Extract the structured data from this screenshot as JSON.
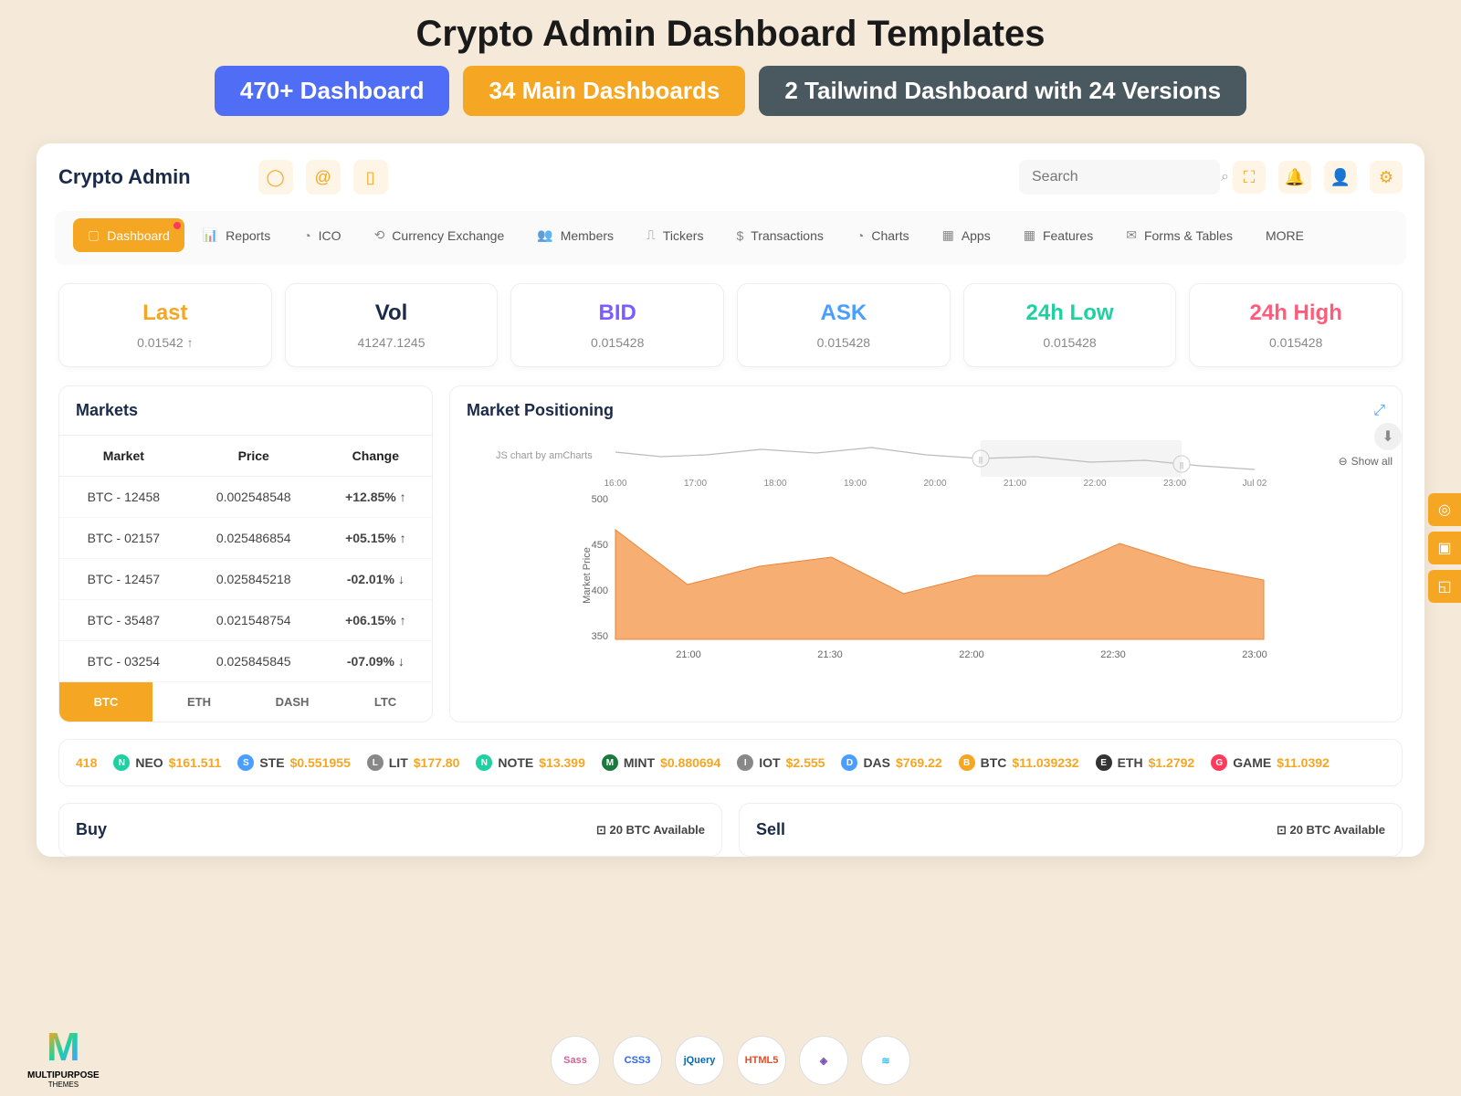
{
  "promo": {
    "title": "Crypto Admin Dashboard Templates",
    "badge1": "470+ Dashboard",
    "badge2": "34 Main Dashboards",
    "badge3": "2 Tailwind Dashboard with 24 Versions"
  },
  "brand": "Crypto Admin",
  "search_placeholder": "Search",
  "nav": [
    {
      "label": "Dashboard",
      "active": true,
      "dot": true,
      "icon": "▢"
    },
    {
      "label": "Reports",
      "icon": "📊"
    },
    {
      "label": "ICO",
      "icon": "◔"
    },
    {
      "label": "Currency Exchange",
      "icon": "⟲"
    },
    {
      "label": "Members",
      "icon": "👥"
    },
    {
      "label": "Tickers",
      "icon": "⎍"
    },
    {
      "label": "Transactions",
      "icon": "$"
    },
    {
      "label": "Charts",
      "icon": "◔"
    },
    {
      "label": "Apps",
      "icon": "▦"
    },
    {
      "label": "Features",
      "icon": "▦"
    },
    {
      "label": "Forms & Tables",
      "icon": "✉"
    },
    {
      "label": "MORE"
    }
  ],
  "stats": [
    {
      "label": "Last",
      "value": "0.01542 ↑",
      "cls": "stat-orange"
    },
    {
      "label": "Vol",
      "value": "41247.1245",
      "cls": "stat-dark"
    },
    {
      "label": "BID",
      "value": "0.015428",
      "cls": "stat-purple"
    },
    {
      "label": "ASK",
      "value": "0.015428",
      "cls": "stat-blue"
    },
    {
      "label": "24h Low",
      "value": "0.015428",
      "cls": "stat-teal"
    },
    {
      "label": "24h High",
      "value": "0.015428",
      "cls": "stat-red"
    }
  ],
  "markets": {
    "title": "Markets",
    "headers": [
      "Market",
      "Price",
      "Change"
    ],
    "rows": [
      {
        "market": "BTC - 12458",
        "price": "0.002548548",
        "change": "+12.85%",
        "dir": "up"
      },
      {
        "market": "BTC - 02157",
        "price": "0.025486854",
        "change": "+05.15%",
        "dir": "up"
      },
      {
        "market": "BTC - 12457",
        "price": "0.025845218",
        "change": "-02.01%",
        "dir": "down"
      },
      {
        "market": "BTC - 35487",
        "price": "0.021548754",
        "change": "+06.15%",
        "dir": "up"
      },
      {
        "market": "BTC - 03254",
        "price": "0.025845845",
        "change": "-07.09%",
        "dir": "down"
      }
    ],
    "tabs": [
      "BTC",
      "ETH",
      "DASH",
      "LTC"
    ],
    "active_tab": "BTC"
  },
  "chart": {
    "title": "Market Positioning",
    "credit": "JS chart by amCharts",
    "showall": "Show all",
    "ylabel": "Market Price"
  },
  "chart_data": {
    "type": "area",
    "title": "Market Positioning",
    "ylabel": "Market Price",
    "ylim": [
      350,
      500
    ],
    "overview_x_ticks": [
      "16:00",
      "17:00",
      "18:00",
      "19:00",
      "20:00",
      "21:00",
      "22:00",
      "23:00",
      "Jul 02"
    ],
    "x_ticks": [
      "21:00",
      "21:30",
      "22:00",
      "22:30",
      "23:00"
    ],
    "x": [
      "20:45",
      "21:00",
      "21:15",
      "21:30",
      "21:45",
      "22:00",
      "22:15",
      "22:30",
      "22:45",
      "23:00"
    ],
    "values": [
      470,
      410,
      430,
      440,
      400,
      420,
      420,
      455,
      430,
      415
    ]
  },
  "ticker_lead": "418",
  "ticker": [
    {
      "sym": "NEO",
      "price": "$161.511",
      "color": "#1dd1a1"
    },
    {
      "sym": "STE",
      "price": "$0.551955",
      "color": "#4a9eff"
    },
    {
      "sym": "LIT",
      "price": "$177.80",
      "color": "#888"
    },
    {
      "sym": "NOTE",
      "price": "$13.399",
      "color": "#1dd1a1"
    },
    {
      "sym": "MINT",
      "price": "$0.880694",
      "color": "#1a7a3d"
    },
    {
      "sym": "IOT",
      "price": "$2.555",
      "color": "#888"
    },
    {
      "sym": "DAS",
      "price": "$769.22",
      "color": "#4a9eff"
    },
    {
      "sym": "BTC",
      "price": "$11.039232",
      "color": "#f5a623"
    },
    {
      "sym": "ETH",
      "price": "$1.2792",
      "color": "#333"
    },
    {
      "sym": "GAME",
      "price": "$11.0392",
      "color": "#ff3b5c"
    }
  ],
  "buy": {
    "title": "Buy",
    "avail": "⊡ 20 BTC Available"
  },
  "sell": {
    "title": "Sell",
    "avail": "⊡ 20 BTC Available"
  },
  "tech": [
    "Sass",
    "CSS3",
    "jQuery",
    "HTML5",
    "◈",
    "≋"
  ],
  "mp_logo": {
    "brand": "MULTIPURPOSE",
    "sub": "THEMES"
  }
}
